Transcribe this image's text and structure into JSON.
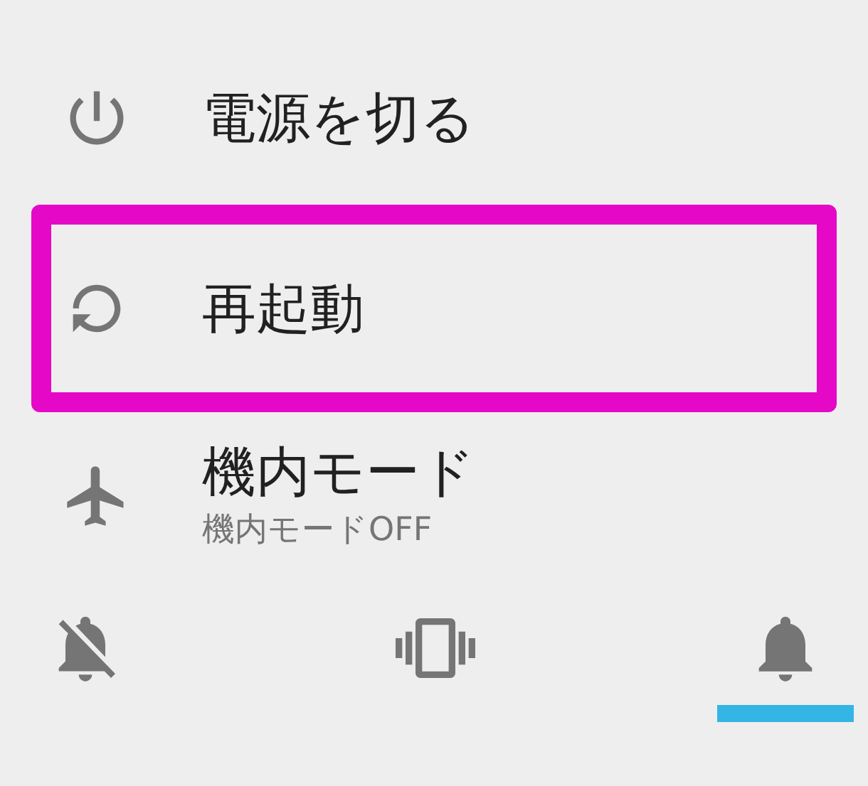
{
  "menu_items": [
    {
      "kind": "power",
      "title": "電源を切る",
      "highlighted": false
    },
    {
      "kind": "restart",
      "title": "再起動",
      "highlighted": true
    },
    {
      "kind": "airplane",
      "title": "機内モード",
      "subtitle": "機内モードOFF",
      "highlighted": false
    }
  ],
  "sound_modes": [
    {
      "kind": "silent",
      "selected": false
    },
    {
      "kind": "vibrate",
      "selected": false
    },
    {
      "kind": "sound",
      "selected": true
    }
  ]
}
